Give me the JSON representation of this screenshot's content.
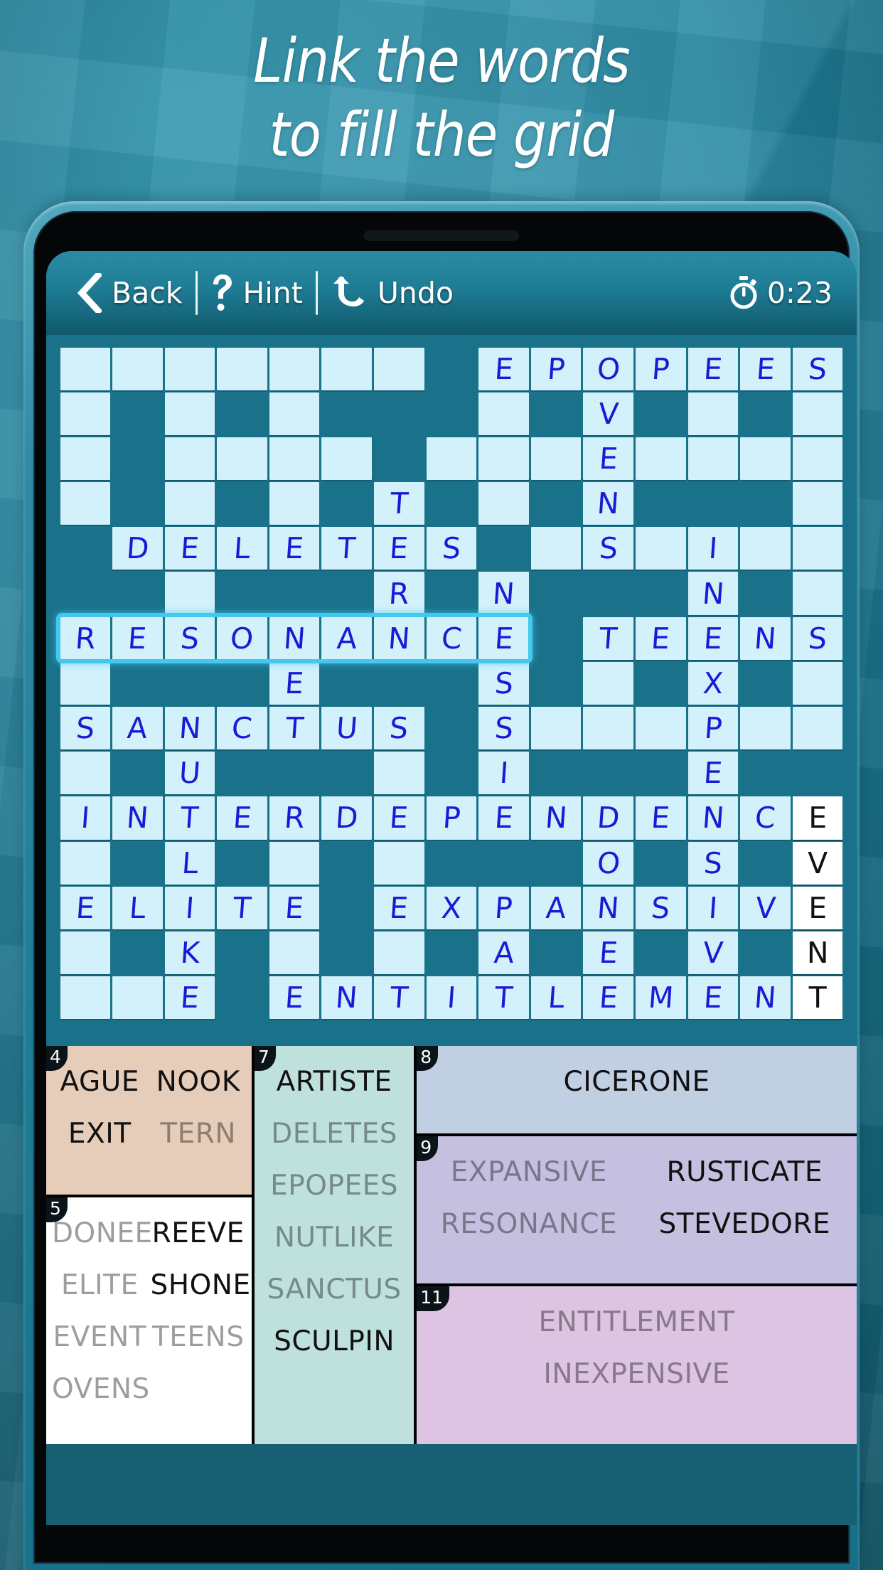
{
  "headline": {
    "line1": "Link the words",
    "line2": "to fill the grid"
  },
  "toolbar": {
    "back_label": "Back",
    "back_icon": "chevron-left-icon",
    "hint_label": "Hint",
    "hint_icon": "question-mark-icon",
    "undo_label": "Undo",
    "undo_icon": "undo-arrow-icon",
    "timer_icon": "stopwatch-icon",
    "timer_value": "0:23"
  },
  "colors": {
    "background": "#1f8aa6",
    "screen": "#19728a",
    "cell_open": "#d2f1fb",
    "cell_white": "#ffffff",
    "letter_blue": "#1a1ad6",
    "selection": "#44c8f0",
    "panel4": "#e5cdb9",
    "panel5": "#ffffff",
    "panel7": "#bfe1de",
    "panel8": "#c0cfe2",
    "panel9": "#c6c0e0",
    "panel11": "#ddc4e2"
  },
  "grid": {
    "cols": 15,
    "rows": 15,
    "selection": {
      "row": 6,
      "col_start": 0,
      "col_end": 8
    },
    "cells": [
      [
        {
          "s": "o",
          "l": ""
        },
        {
          "s": "o",
          "l": ""
        },
        {
          "s": "o",
          "l": ""
        },
        {
          "s": "o",
          "l": ""
        },
        {
          "s": "o",
          "l": ""
        },
        {
          "s": "o",
          "l": ""
        },
        {
          "s": "o",
          "l": ""
        },
        {
          "s": "b",
          "l": ""
        },
        {
          "s": "o",
          "l": "E"
        },
        {
          "s": "o",
          "l": "P"
        },
        {
          "s": "o",
          "l": "O"
        },
        {
          "s": "o",
          "l": "P"
        },
        {
          "s": "o",
          "l": "E"
        },
        {
          "s": "o",
          "l": "E"
        },
        {
          "s": "o",
          "l": "S"
        }
      ],
      [
        {
          "s": "o",
          "l": ""
        },
        {
          "s": "b",
          "l": ""
        },
        {
          "s": "o",
          "l": ""
        },
        {
          "s": "b",
          "l": ""
        },
        {
          "s": "o",
          "l": ""
        },
        {
          "s": "b",
          "l": ""
        },
        {
          "s": "b",
          "l": ""
        },
        {
          "s": "b",
          "l": ""
        },
        {
          "s": "o",
          "l": ""
        },
        {
          "s": "b",
          "l": ""
        },
        {
          "s": "o",
          "l": "V"
        },
        {
          "s": "b",
          "l": ""
        },
        {
          "s": "o",
          "l": ""
        },
        {
          "s": "b",
          "l": ""
        },
        {
          "s": "o",
          "l": ""
        }
      ],
      [
        {
          "s": "o",
          "l": ""
        },
        {
          "s": "b",
          "l": ""
        },
        {
          "s": "o",
          "l": ""
        },
        {
          "s": "o",
          "l": ""
        },
        {
          "s": "o",
          "l": ""
        },
        {
          "s": "o",
          "l": ""
        },
        {
          "s": "b",
          "l": ""
        },
        {
          "s": "o",
          "l": ""
        },
        {
          "s": "o",
          "l": ""
        },
        {
          "s": "o",
          "l": ""
        },
        {
          "s": "o",
          "l": "E"
        },
        {
          "s": "o",
          "l": ""
        },
        {
          "s": "o",
          "l": ""
        },
        {
          "s": "o",
          "l": ""
        },
        {
          "s": "o",
          "l": ""
        }
      ],
      [
        {
          "s": "o",
          "l": ""
        },
        {
          "s": "b",
          "l": ""
        },
        {
          "s": "o",
          "l": ""
        },
        {
          "s": "b",
          "l": ""
        },
        {
          "s": "o",
          "l": ""
        },
        {
          "s": "b",
          "l": ""
        },
        {
          "s": "o",
          "l": "T"
        },
        {
          "s": "b",
          "l": ""
        },
        {
          "s": "o",
          "l": ""
        },
        {
          "s": "b",
          "l": ""
        },
        {
          "s": "o",
          "l": "N"
        },
        {
          "s": "b",
          "l": ""
        },
        {
          "s": "b",
          "l": ""
        },
        {
          "s": "b",
          "l": ""
        },
        {
          "s": "o",
          "l": ""
        }
      ],
      [
        {
          "s": "b",
          "l": ""
        },
        {
          "s": "o",
          "l": "D"
        },
        {
          "s": "o",
          "l": "E"
        },
        {
          "s": "o",
          "l": "L"
        },
        {
          "s": "o",
          "l": "E"
        },
        {
          "s": "o",
          "l": "T"
        },
        {
          "s": "o",
          "l": "E"
        },
        {
          "s": "o",
          "l": "S"
        },
        {
          "s": "b",
          "l": ""
        },
        {
          "s": "o",
          "l": ""
        },
        {
          "s": "o",
          "l": "S"
        },
        {
          "s": "o",
          "l": ""
        },
        {
          "s": "o",
          "l": "I"
        },
        {
          "s": "o",
          "l": ""
        },
        {
          "s": "o",
          "l": ""
        }
      ],
      [
        {
          "s": "b",
          "l": ""
        },
        {
          "s": "b",
          "l": ""
        },
        {
          "s": "o",
          "l": ""
        },
        {
          "s": "b",
          "l": ""
        },
        {
          "s": "b",
          "l": ""
        },
        {
          "s": "b",
          "l": ""
        },
        {
          "s": "o",
          "l": "R"
        },
        {
          "s": "b",
          "l": ""
        },
        {
          "s": "o",
          "l": "N"
        },
        {
          "s": "b",
          "l": ""
        },
        {
          "s": "b",
          "l": ""
        },
        {
          "s": "b",
          "l": ""
        },
        {
          "s": "o",
          "l": "N"
        },
        {
          "s": "b",
          "l": ""
        },
        {
          "s": "o",
          "l": ""
        }
      ],
      [
        {
          "s": "o",
          "l": "R"
        },
        {
          "s": "o",
          "l": "E"
        },
        {
          "s": "o",
          "l": "S"
        },
        {
          "s": "o",
          "l": "O"
        },
        {
          "s": "o",
          "l": "N"
        },
        {
          "s": "o",
          "l": "A"
        },
        {
          "s": "o",
          "l": "N"
        },
        {
          "s": "o",
          "l": "C"
        },
        {
          "s": "o",
          "l": "E"
        },
        {
          "s": "b",
          "l": ""
        },
        {
          "s": "o",
          "l": "T"
        },
        {
          "s": "o",
          "l": "E"
        },
        {
          "s": "o",
          "l": "E"
        },
        {
          "s": "o",
          "l": "N"
        },
        {
          "s": "o",
          "l": "S"
        }
      ],
      [
        {
          "s": "o",
          "l": ""
        },
        {
          "s": "b",
          "l": ""
        },
        {
          "s": "b",
          "l": ""
        },
        {
          "s": "b",
          "l": ""
        },
        {
          "s": "o",
          "l": "E"
        },
        {
          "s": "b",
          "l": ""
        },
        {
          "s": "b",
          "l": ""
        },
        {
          "s": "b",
          "l": ""
        },
        {
          "s": "o",
          "l": "S"
        },
        {
          "s": "b",
          "l": ""
        },
        {
          "s": "o",
          "l": ""
        },
        {
          "s": "b",
          "l": ""
        },
        {
          "s": "o",
          "l": "X"
        },
        {
          "s": "b",
          "l": ""
        },
        {
          "s": "o",
          "l": ""
        }
      ],
      [
        {
          "s": "o",
          "l": "S"
        },
        {
          "s": "o",
          "l": "A"
        },
        {
          "s": "o",
          "l": "N"
        },
        {
          "s": "o",
          "l": "C"
        },
        {
          "s": "o",
          "l": "T"
        },
        {
          "s": "o",
          "l": "U"
        },
        {
          "s": "o",
          "l": "S"
        },
        {
          "s": "b",
          "l": ""
        },
        {
          "s": "o",
          "l": "S"
        },
        {
          "s": "o",
          "l": ""
        },
        {
          "s": "o",
          "l": ""
        },
        {
          "s": "o",
          "l": ""
        },
        {
          "s": "o",
          "l": "P"
        },
        {
          "s": "o",
          "l": ""
        },
        {
          "s": "o",
          "l": ""
        }
      ],
      [
        {
          "s": "o",
          "l": ""
        },
        {
          "s": "b",
          "l": ""
        },
        {
          "s": "o",
          "l": "U"
        },
        {
          "s": "b",
          "l": ""
        },
        {
          "s": "b",
          "l": ""
        },
        {
          "s": "b",
          "l": ""
        },
        {
          "s": "o",
          "l": ""
        },
        {
          "s": "b",
          "l": ""
        },
        {
          "s": "o",
          "l": "I"
        },
        {
          "s": "b",
          "l": ""
        },
        {
          "s": "b",
          "l": ""
        },
        {
          "s": "b",
          "l": ""
        },
        {
          "s": "o",
          "l": "E"
        },
        {
          "s": "b",
          "l": ""
        },
        {
          "s": "b",
          "l": ""
        }
      ],
      [
        {
          "s": "o",
          "l": "I"
        },
        {
          "s": "o",
          "l": "N"
        },
        {
          "s": "o",
          "l": "T"
        },
        {
          "s": "o",
          "l": "E"
        },
        {
          "s": "o",
          "l": "R"
        },
        {
          "s": "o",
          "l": "D"
        },
        {
          "s": "o",
          "l": "E"
        },
        {
          "s": "o",
          "l": "P"
        },
        {
          "s": "o",
          "l": "E"
        },
        {
          "s": "o",
          "l": "N"
        },
        {
          "s": "o",
          "l": "D"
        },
        {
          "s": "o",
          "l": "E"
        },
        {
          "s": "o",
          "l": "N"
        },
        {
          "s": "o",
          "l": "C"
        },
        {
          "s": "w",
          "l": "E"
        }
      ],
      [
        {
          "s": "o",
          "l": ""
        },
        {
          "s": "b",
          "l": ""
        },
        {
          "s": "o",
          "l": "L"
        },
        {
          "s": "b",
          "l": ""
        },
        {
          "s": "o",
          "l": ""
        },
        {
          "s": "b",
          "l": ""
        },
        {
          "s": "o",
          "l": ""
        },
        {
          "s": "b",
          "l": ""
        },
        {
          "s": "b",
          "l": ""
        },
        {
          "s": "b",
          "l": ""
        },
        {
          "s": "o",
          "l": "O"
        },
        {
          "s": "b",
          "l": ""
        },
        {
          "s": "o",
          "l": "S"
        },
        {
          "s": "b",
          "l": ""
        },
        {
          "s": "w",
          "l": "V"
        }
      ],
      [
        {
          "s": "o",
          "l": "E"
        },
        {
          "s": "o",
          "l": "L"
        },
        {
          "s": "o",
          "l": "I"
        },
        {
          "s": "o",
          "l": "T"
        },
        {
          "s": "o",
          "l": "E"
        },
        {
          "s": "b",
          "l": ""
        },
        {
          "s": "o",
          "l": "E"
        },
        {
          "s": "o",
          "l": "X"
        },
        {
          "s": "o",
          "l": "P"
        },
        {
          "s": "o",
          "l": "A"
        },
        {
          "s": "o",
          "l": "N"
        },
        {
          "s": "o",
          "l": "S"
        },
        {
          "s": "o",
          "l": "I"
        },
        {
          "s": "o",
          "l": "V"
        },
        {
          "s": "w",
          "l": "E"
        }
      ],
      [
        {
          "s": "o",
          "l": ""
        },
        {
          "s": "b",
          "l": ""
        },
        {
          "s": "o",
          "l": "K"
        },
        {
          "s": "b",
          "l": ""
        },
        {
          "s": "o",
          "l": ""
        },
        {
          "s": "b",
          "l": ""
        },
        {
          "s": "o",
          "l": ""
        },
        {
          "s": "b",
          "l": ""
        },
        {
          "s": "o",
          "l": "A"
        },
        {
          "s": "b",
          "l": ""
        },
        {
          "s": "o",
          "l": "E"
        },
        {
          "s": "b",
          "l": ""
        },
        {
          "s": "o",
          "l": "V"
        },
        {
          "s": "b",
          "l": ""
        },
        {
          "s": "w",
          "l": "N"
        }
      ],
      [
        {
          "s": "o",
          "l": ""
        },
        {
          "s": "o",
          "l": ""
        },
        {
          "s": "o",
          "l": "E"
        },
        {
          "s": "b",
          "l": ""
        },
        {
          "s": "o",
          "l": "E"
        },
        {
          "s": "o",
          "l": "N"
        },
        {
          "s": "o",
          "l": "T"
        },
        {
          "s": "o",
          "l": "I"
        },
        {
          "s": "o",
          "l": "T"
        },
        {
          "s": "o",
          "l": "L"
        },
        {
          "s": "o",
          "l": "E"
        },
        {
          "s": "o",
          "l": "M"
        },
        {
          "s": "o",
          "l": "E"
        },
        {
          "s": "o",
          "l": "N"
        },
        {
          "s": "w",
          "l": "T"
        }
      ]
    ]
  },
  "panels": [
    {
      "number": "4",
      "bg": "#e5cdb9",
      "columns": 2,
      "words": [
        {
          "text": "AGUE",
          "used": false
        },
        {
          "text": "NOOK",
          "used": false
        },
        {
          "text": "EXIT",
          "used": false
        },
        {
          "text": "TERN",
          "used": true
        }
      ]
    },
    {
      "number": "5",
      "bg": "#ffffff",
      "columns": 2,
      "words": [
        {
          "text": "DONEE",
          "used": true
        },
        {
          "text": "REEVE",
          "used": false
        },
        {
          "text": "ELITE",
          "used": true
        },
        {
          "text": "SHONE",
          "used": false
        },
        {
          "text": "EVENT",
          "used": true
        },
        {
          "text": "TEENS",
          "used": true
        },
        {
          "text": "OVENS",
          "used": true
        },
        {
          "text": "",
          "used": true
        }
      ]
    },
    {
      "number": "7",
      "bg": "#bfe1de",
      "columns": 1,
      "words": [
        {
          "text": "ARTISTE",
          "used": false
        },
        {
          "text": "DELETES",
          "used": true
        },
        {
          "text": "EPOPEES",
          "used": true
        },
        {
          "text": "NUTLIKE",
          "used": true
        },
        {
          "text": "SANCTUS",
          "used": true
        },
        {
          "text": "SCULPIN",
          "used": false
        }
      ]
    },
    {
      "number": "8",
      "bg": "#c0cfe2",
      "columns": 1,
      "words": [
        {
          "text": "CICERONE",
          "used": false
        }
      ]
    },
    {
      "number": "9",
      "bg": "#c6c0e0",
      "columns": 2,
      "words": [
        {
          "text": "EXPANSIVE",
          "used": true
        },
        {
          "text": "RUSTICATE",
          "used": false
        },
        {
          "text": "RESONANCE",
          "used": true
        },
        {
          "text": "STEVEDORE",
          "used": false
        }
      ]
    },
    {
      "number": "11",
      "bg": "#ddc4e2",
      "columns": 1,
      "words": [
        {
          "text": "ENTITLEMENT",
          "used": true
        },
        {
          "text": "INEXPENSIVE",
          "used": true
        }
      ]
    }
  ]
}
